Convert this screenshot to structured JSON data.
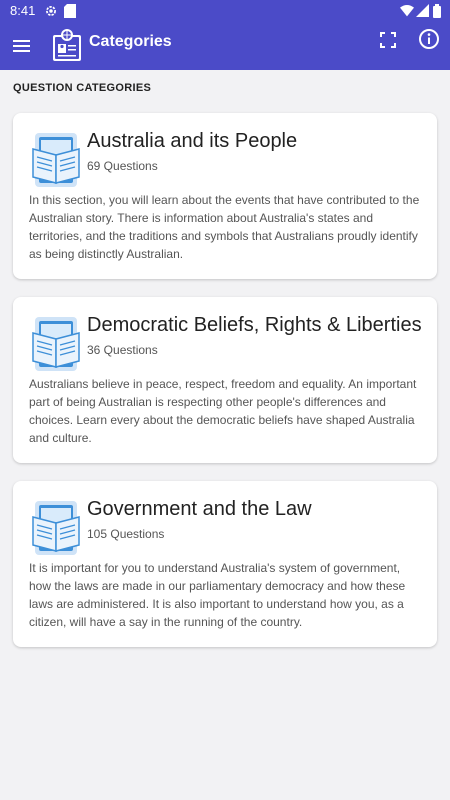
{
  "status_bar": {
    "time": "8:41"
  },
  "app_bar": {
    "title": "Categories",
    "background": "#4b4bc8"
  },
  "section": {
    "title": "QUESTION CATEGORIES"
  },
  "categories": [
    {
      "title": "Australia and its People",
      "count": "69 Questions",
      "description": "In this section, you will learn about the events that have contributed to the Australian story. There is information about Australia's states and territories, and the traditions and symbols that Australians proudly identify as being distinctly Australian."
    },
    {
      "title": "Democratic Beliefs, Rights & Liberties",
      "count": "36 Questions",
      "description": "Australians believe in peace, respect, freedom and equality. An important part of being Australian is respecting other people's differences and choices. Learn every about the democratic beliefs have shaped Australia and culture."
    },
    {
      "title": "Government and the Law",
      "count": "105 Questions",
      "description": "It is important for you to understand Australia's system of government, how the laws are made in our parliamentary democracy and how these laws are administered. It is also important to understand how you, as a citizen, will have a say in the running of the country."
    }
  ]
}
